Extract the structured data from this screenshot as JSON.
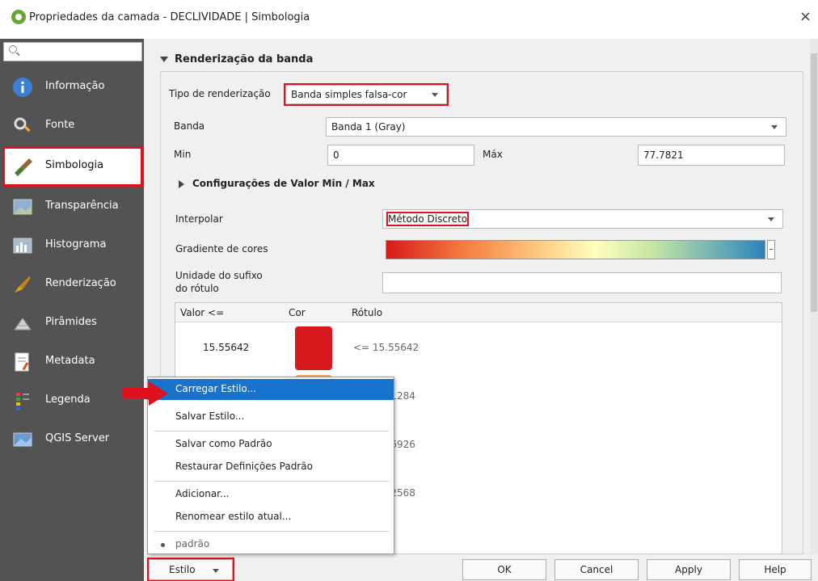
{
  "window": {
    "title": "Propriedades da camada - DECLIVIDADE | Simbologia",
    "close": "×"
  },
  "sidebar": {
    "items": [
      {
        "label": "Informação",
        "icon": "info-icon"
      },
      {
        "label": "Fonte",
        "icon": "source-icon"
      },
      {
        "label": "Simbologia",
        "icon": "paintbrush-icon",
        "active": true
      },
      {
        "label": "Transparência",
        "icon": "transparency-icon"
      },
      {
        "label": "Histograma",
        "icon": "histogram-icon"
      },
      {
        "label": "Renderização",
        "icon": "render-icon"
      },
      {
        "label": "Pirâmides",
        "icon": "pyramid-icon"
      },
      {
        "label": "Metadata",
        "icon": "metadata-icon"
      },
      {
        "label": "Legenda",
        "icon": "legend-icon"
      },
      {
        "label": "QGIS Server",
        "icon": "server-icon"
      }
    ]
  },
  "render": {
    "section_title": "Renderização da banda",
    "type_label": "Tipo de renderização",
    "type_value": "Banda simples falsa-cor",
    "band_label": "Banda",
    "band_value": "Banda 1 (Gray)",
    "min_label": "Min",
    "min_value": "0",
    "max_label": "Máx",
    "max_value": "77.7821",
    "minmax_section": "Configurações de Valor Min / Max",
    "interp_label": "Interpolar",
    "interp_value": "Método Discreto",
    "gradient_label": "Gradiente de cores",
    "suffix_label_1": "Unidade do sufixo",
    "suffix_label_2": "do rótulo",
    "suffix_value": ""
  },
  "table": {
    "headers": [
      "Valor <=",
      "Cor",
      "Rótulo"
    ],
    "rows": [
      {
        "value": "15.55642",
        "color": "#d7191c",
        "label": "<= 15.55642"
      },
      {
        "value": "",
        "color": "#f4a35a",
        "label": "2 - 31.11284"
      },
      {
        "value": "",
        "color": "#ffffbf",
        "label": "4 - 46.66926"
      },
      {
        "value": "",
        "color": "#abdda4",
        "label": "6 - 62.22568"
      },
      {
        "value": "",
        "color": "#2b83ba",
        "label": "568"
      }
    ]
  },
  "menu": {
    "items": [
      "Carregar Estilo...",
      "Salvar Estilo...",
      "Salvar como Padrão",
      "Restaurar Definições Padrão",
      "Adicionar...",
      "Renomear estilo atual...",
      "padrão"
    ]
  },
  "buttons": {
    "estilo": "Estilo",
    "ok": "OK",
    "cancel": "Cancel",
    "apply": "Apply",
    "help": "Help"
  },
  "colors": {
    "highlight": "#e0101e",
    "menu_selected": "#1873cc",
    "sidebar_bg": "#535353"
  }
}
